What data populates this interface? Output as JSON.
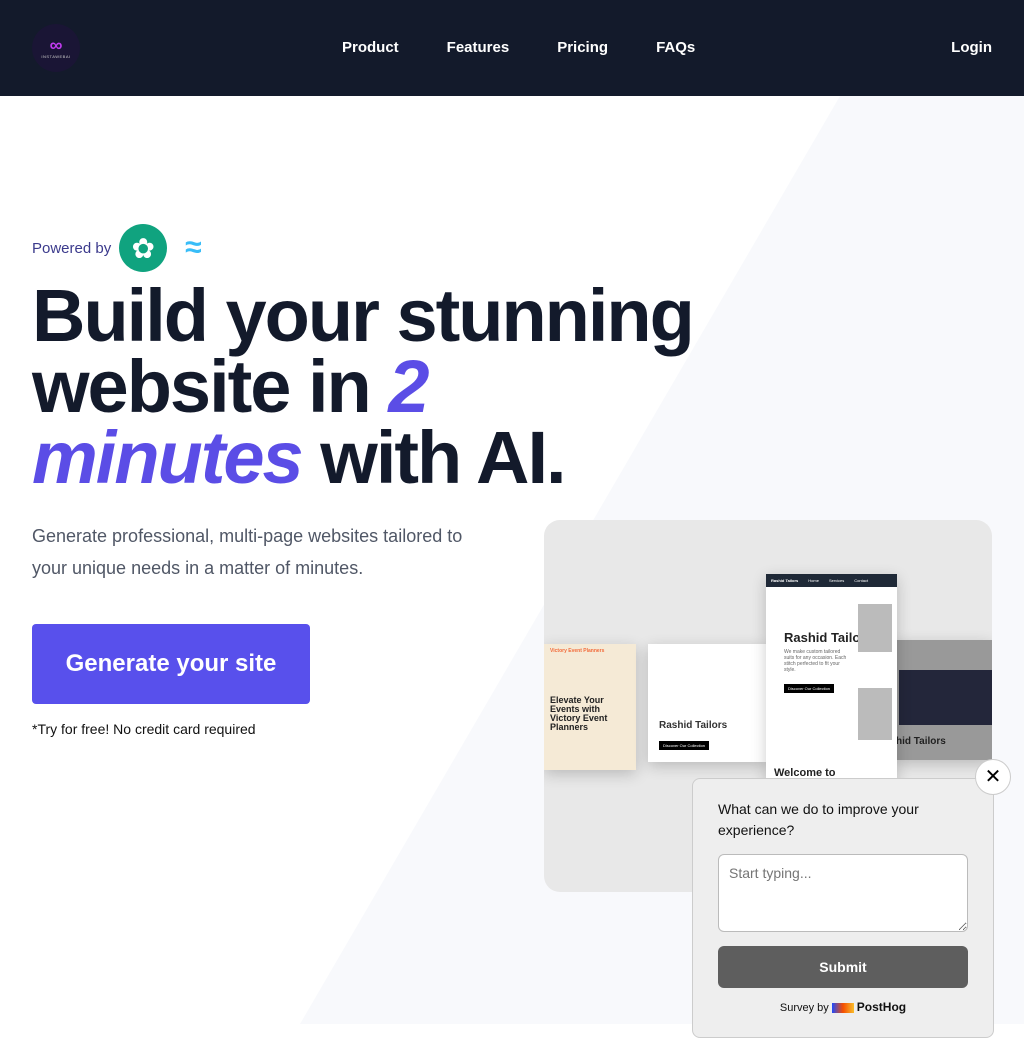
{
  "nav": {
    "logo_text": "INSTAWEBAI",
    "links": [
      "Product",
      "Features",
      "Pricing",
      "FAQs"
    ],
    "login": "Login"
  },
  "hero": {
    "powered_by": "Powered by",
    "title_1": "Build your stunning website in ",
    "title_accent_1": "2",
    "title_accent_2": "minutes",
    "title_2": " with AI.",
    "subtitle": "Generate professional, multi-page websites tailored to your unique needs in a matter of minutes.",
    "cta": "Generate your site",
    "note": "*Try for free! No credit card required"
  },
  "preview": {
    "c1_brand": "Victory Event Planners",
    "c1_title": "Elevate Your Events with Victory Event Planners",
    "c2_title": "Rashid Tailors",
    "c2_button": "Discover Our Collection",
    "c3_nav": [
      "Rashid Tailors",
      "Home",
      "Services",
      "Contact"
    ],
    "c3_title": "Rashid Tailors",
    "c3_text": "We make custom tailored suits for any occasion. Each stitch perfected to fit your style.",
    "c3_button": "Discover Our Collection",
    "c3_welcome": "Welcome to",
    "c4_title": "hid Tailors"
  },
  "survey": {
    "question": "What can we do to improve your experience?",
    "placeholder": "Start typing...",
    "submit": "Submit",
    "by": "Survey by",
    "brand": "PostHog"
  },
  "colors": {
    "nav_bg": "#131a2b",
    "accent": "#5850ec"
  }
}
